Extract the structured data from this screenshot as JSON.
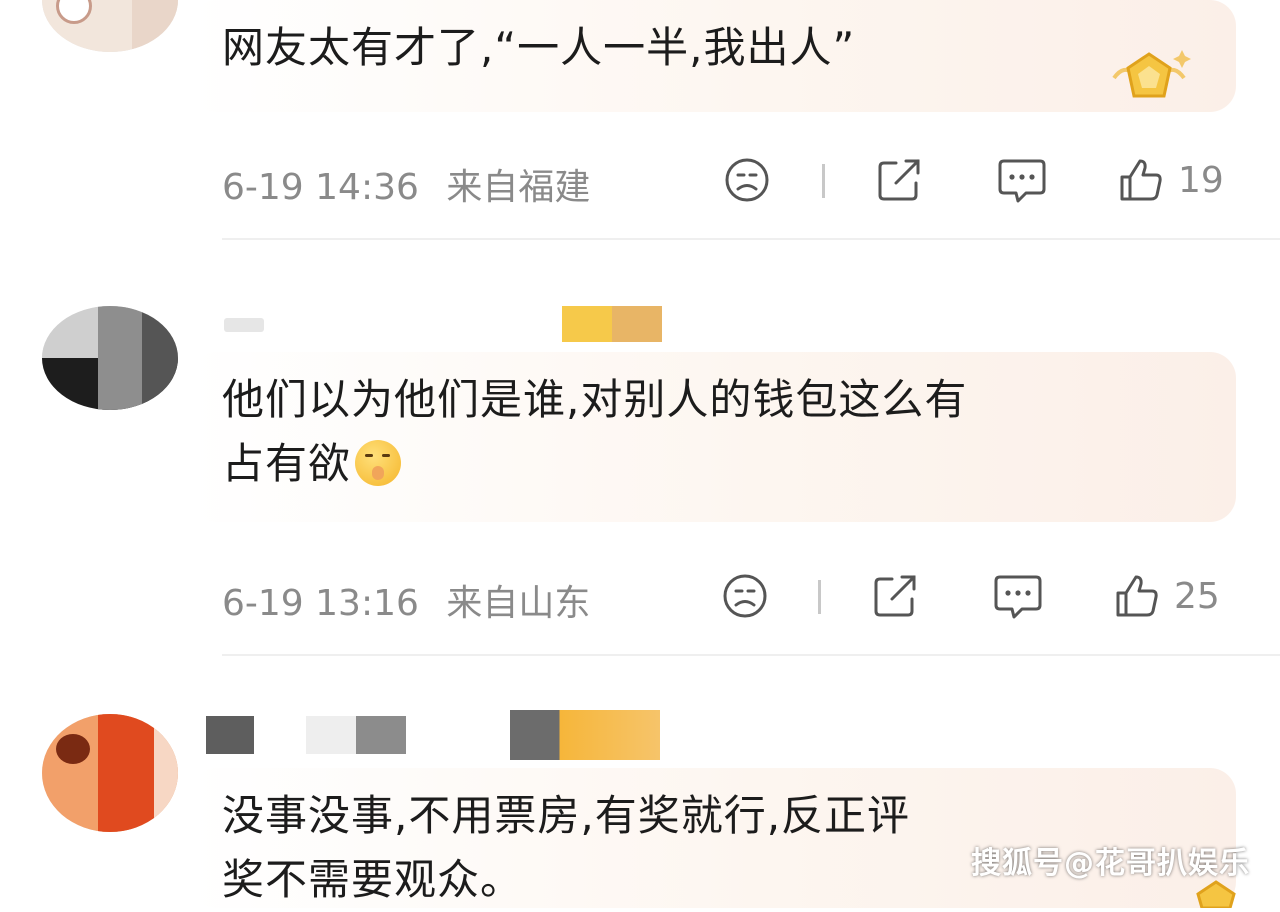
{
  "comments": [
    {
      "text_lines": [
        "网友太有才了,“一人一半,我出人”"
      ],
      "time": "6-19 14:36",
      "location": "来自福建",
      "likes": "19",
      "avatar_colors": [
        "#e8d8cc",
        "#f5e9df"
      ]
    },
    {
      "text_lines": [
        "他们以为他们是谁,对别人的钱包这么有",
        "占有欲"
      ],
      "emoji": "shushing-face-emoji",
      "time": "6-19 13:16",
      "location": "来自山东",
      "likes": "25",
      "avatar_colors": [
        "#cfcfcf",
        "#1d1d1d"
      ]
    },
    {
      "text_lines": [
        "没事没事,不用票房,有奖就行,反正评",
        "奖不需要观众。"
      ],
      "avatar_colors": [
        "#e04a1f",
        "#f29a5c"
      ]
    }
  ],
  "icons": {
    "dislike": "frown-face-icon",
    "share": "share-icon",
    "reply": "comment-icon",
    "like": "thumbs-up-icon"
  },
  "watermark": "搜狐号@花哥扒娱乐",
  "colors": {
    "meta_text": "#8a8a8a",
    "bubble": "#fbefe8",
    "badge": "#f5c542"
  }
}
